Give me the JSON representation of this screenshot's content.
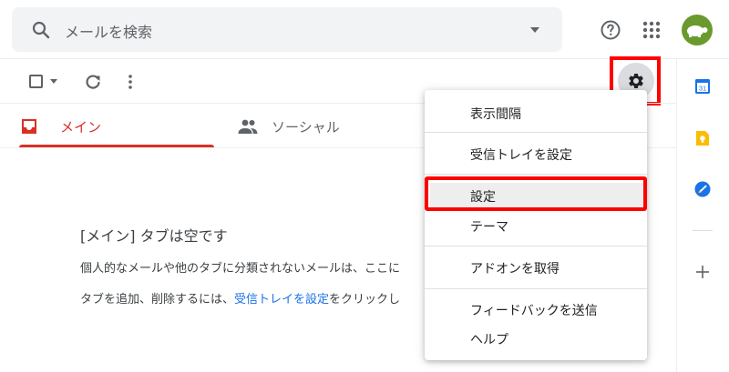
{
  "search": {
    "placeholder": "メールを検索"
  },
  "header": {
    "icons": [
      "search-icon",
      "caret-down-icon",
      "help-icon",
      "apps-icon",
      "avatar"
    ]
  },
  "toolbar": {
    "icons": [
      "checkbox-icon",
      "caret-down-icon",
      "refresh-icon",
      "more-vert-icon",
      "gear-icon"
    ]
  },
  "tabs": [
    {
      "label": "メイン",
      "icon": "inbox-icon",
      "selected": true
    },
    {
      "label": "ソーシャル",
      "icon": "people-icon",
      "selected": false
    }
  ],
  "empty_state": {
    "title": "[メイン] タブは空です",
    "description": "個人的なメールや他のタブに分類されないメールは、ここに",
    "hint_prefix": "タブを追加、削除するには、",
    "hint_link": "受信トレイを設定",
    "hint_suffix": "をクリックし"
  },
  "settings_menu": {
    "items": [
      "表示間隔",
      "受信トレイを設定",
      "設定",
      "テーマ",
      "アドオンを取得",
      "フィードバックを送信",
      "ヘルプ"
    ],
    "highlighted": "設定"
  },
  "side_panel": {
    "icons": [
      "calendar-icon",
      "keep-icon",
      "tasks-icon",
      "add-icon"
    ],
    "calendar_day": "31"
  },
  "colors": {
    "accent_red": "#d93025",
    "link_blue": "#1a73e8",
    "highlight_box": "#ff0000",
    "search_bg": "#f1f3f4"
  }
}
